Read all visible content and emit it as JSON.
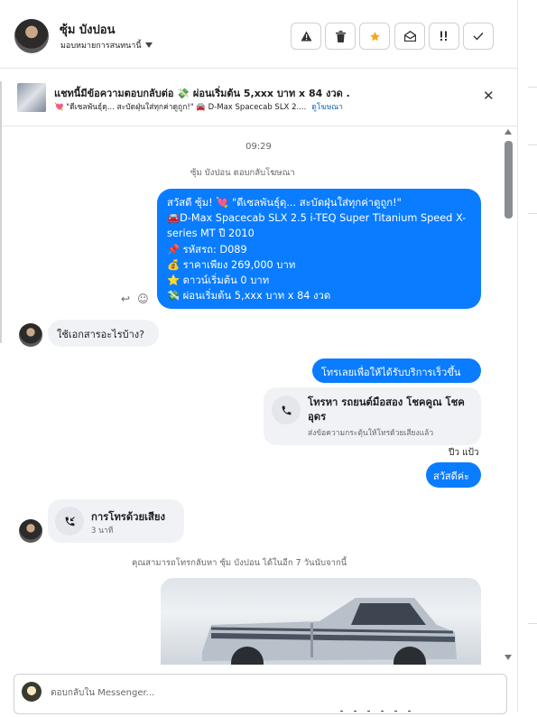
{
  "header": {
    "name": "ซุ้ม บังปอน",
    "assign_label": "มอบหมายการสนทนานี้"
  },
  "banner": {
    "title": "แชทนี้มีข้อความตอบกลับต่อ 💸 ผ่อนเริ่มต้น 5,xxx บาท x 84 งวด .",
    "subtitle": "💘 \"ดีเซลพันธุ์ดุ... สะบัดฝุ่นใส่ทุกค่าดูถูก!\" 🚘 D-Max Spacecab SLX 2....",
    "link": "ดูโฆษณา"
  },
  "messages": {
    "time": "09:29",
    "replied_note": "ซุ้ม บังปอน ตอบกลับโฆษณา",
    "outgoing_big": [
      "สวัสดี ซุ้ม! 💘 \"ดีเซลพันธุ์ดุ... สะบัดฝุ่นใส่ทุกค่าดูถูก!\"",
      "🚘D-Max Spacecab SLX 2.5 i-TEQ Super Titanium Speed X-",
      "series MT ปี 2010",
      "📌 รหัสรถ: D089",
      "💰 ราคาเพียง 269,000 บาท",
      "⭐ ดาวน์เริ่มต้น 0 บาท",
      "💸 ผ่อนเริ่มต้น 5,xxx บาท x 84 งวด"
    ],
    "incoming_question": "ใช้เอกสารอะไรบ้าง?",
    "outgoing_call_request": "โทรเลยเพื่อให้ได้รับบริการเร็วขึ้น",
    "call_card": {
      "title": "โทรหา รถยนต์มือสอง โชคคูณ โชค อุดร",
      "subtitle": "ส่งข้อความกระตุ้นให้โทรด้วยเสียงแล้ว"
    },
    "read_by": "ปีว แป้ว",
    "outgoing_hi": "สวัสดีค่ะ",
    "voice_call": {
      "title": "การโทรด้วยเสียง",
      "duration": "3 นาที"
    },
    "callback_note": "คุณสามารถโทรกลับหา ซุ้ม บังปอน ได้ในอีก 7 วันนับจากนี้"
  },
  "composer": {
    "placeholder": "ตอบกลับใน Messenger..."
  },
  "colors": {
    "accent": "#0a7cff",
    "star": "#f5a623",
    "incoming_bg": "#f0f2f5"
  },
  "icons": [
    "warning-icon",
    "trash-icon",
    "star-icon",
    "mail-open-icon",
    "priority-icon",
    "check-icon",
    "close-icon",
    "reply-icon",
    "emoji-icon",
    "phone-icon",
    "phone-incoming-icon"
  ]
}
